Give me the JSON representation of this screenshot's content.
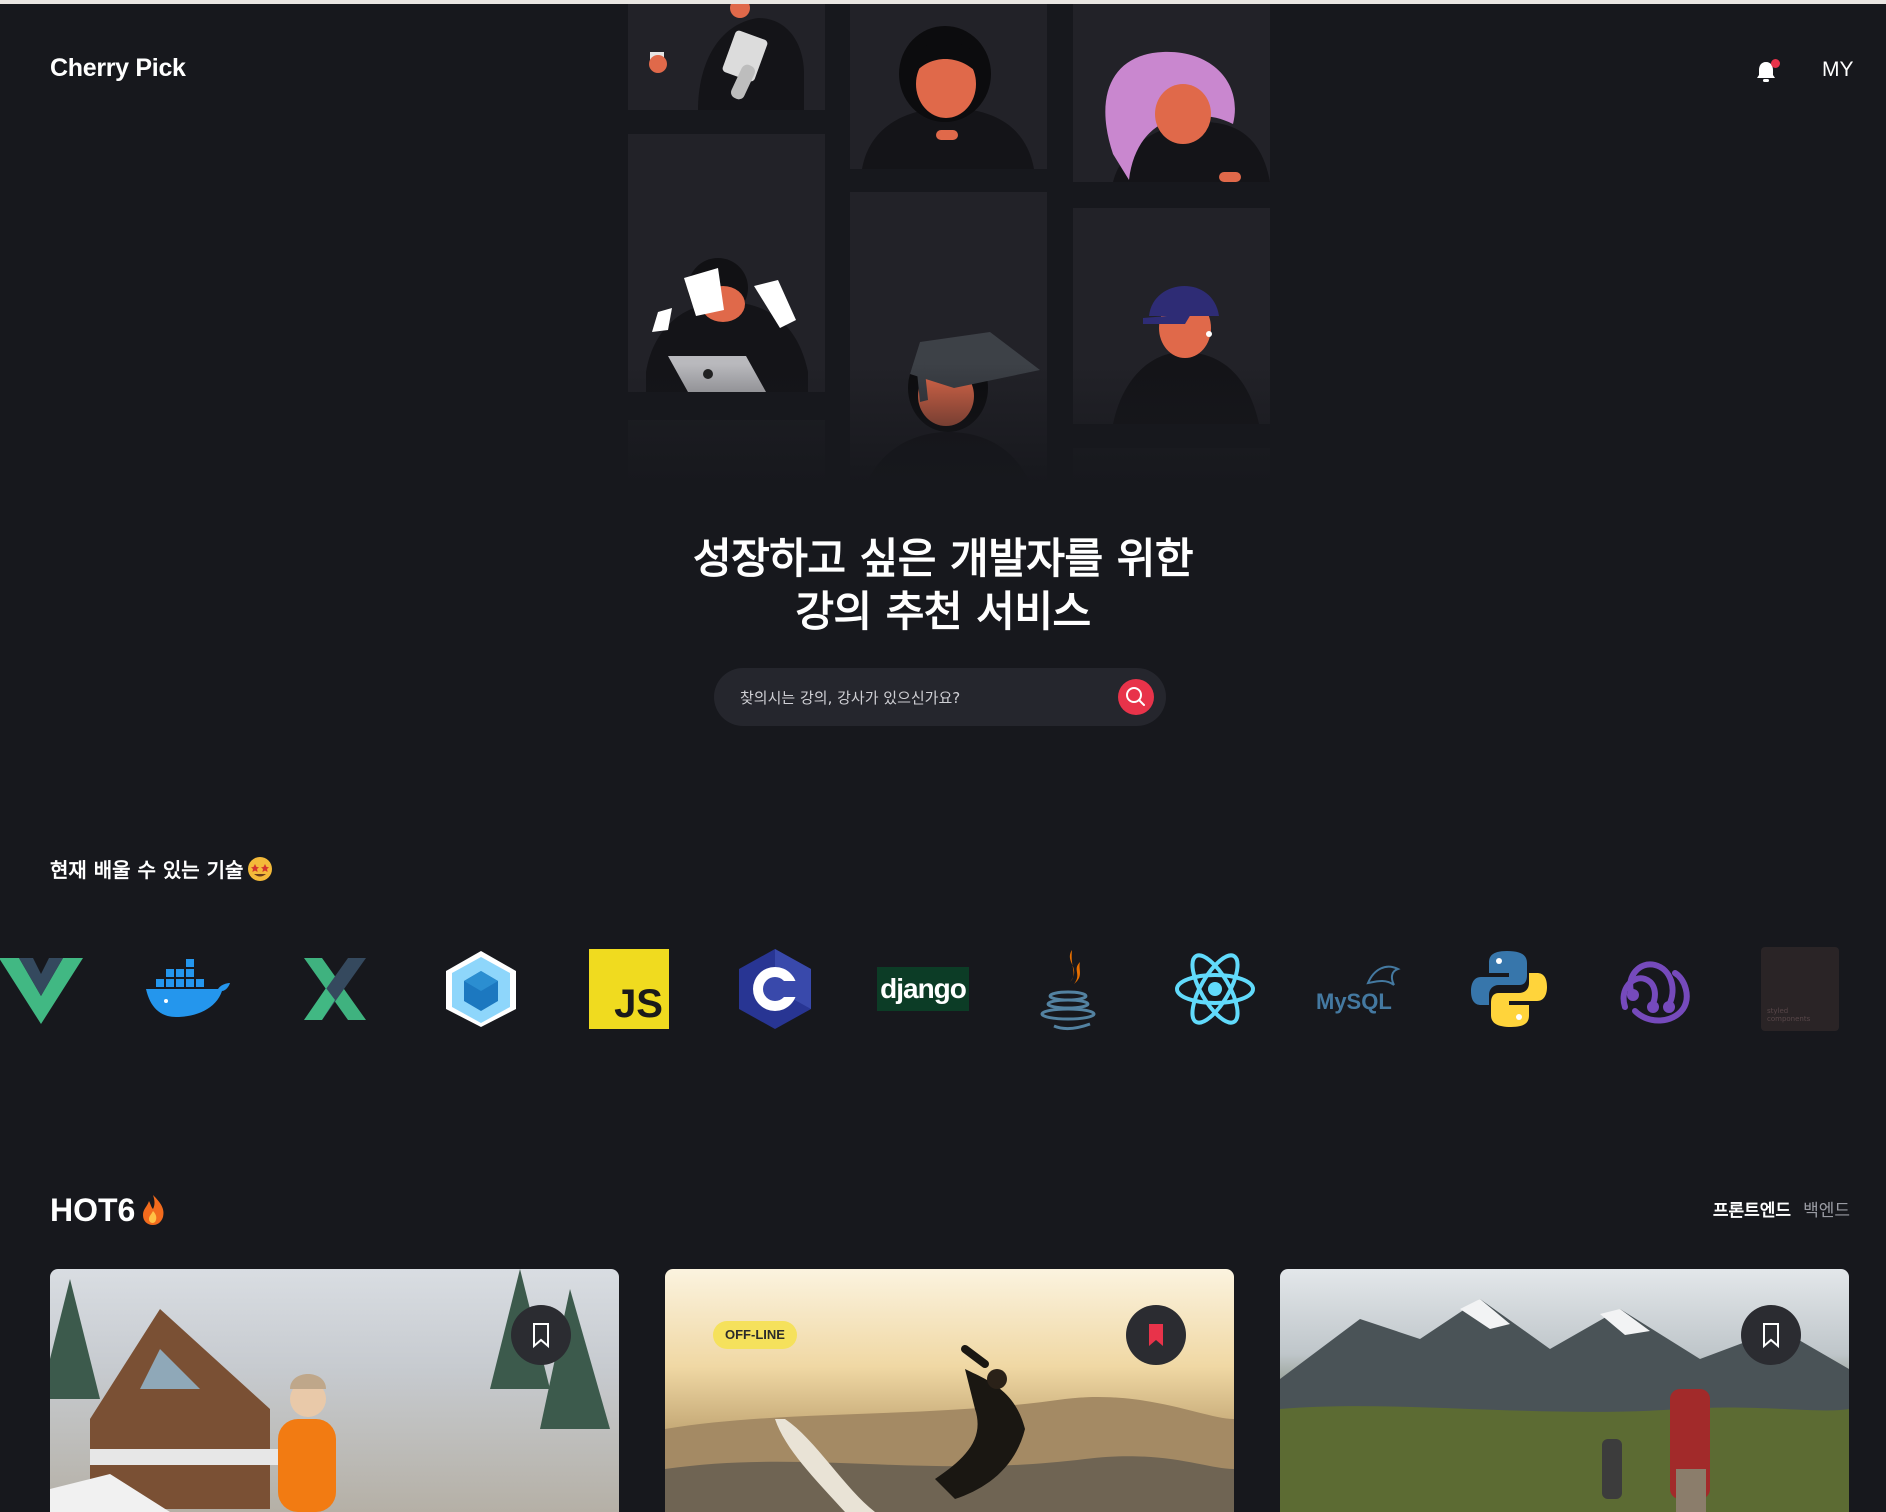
{
  "header": {
    "logo": "Cherry Pick",
    "my_label": "MY"
  },
  "hero": {
    "headline_line1": "성장하고 싶은 개발자를 위한",
    "headline_line2": "강의 추천 서비스"
  },
  "search": {
    "placeholder": "찾의시는 강의, 강사가 있으신가요?"
  },
  "tech_section": {
    "title": "현재 배울 수 있는 기술",
    "logos": [
      "vue",
      "docker",
      "nuxt",
      "webpack",
      "javascript",
      "c",
      "django",
      "java",
      "react",
      "mysql",
      "python",
      "redux",
      "styled-components"
    ],
    "js_text": "JS",
    "django_text": "django",
    "mysql_text": "MySQL",
    "styled_text": "styled components"
  },
  "hot": {
    "title": "HOT6",
    "tabs": [
      "프론트엔드",
      "백엔드"
    ],
    "active_tab": "프론트엔드",
    "cards": [
      {
        "image": "snowy-cabin-woman-orange-jacket",
        "bookmarked": false
      },
      {
        "image": "surfer-wave",
        "bookmarked": true,
        "badge": "OFF-LINE"
      },
      {
        "image": "mountain-hikers",
        "bookmarked": false
      }
    ]
  },
  "colors": {
    "background": "#17181d",
    "accent": "#e8334a",
    "search_bg": "#25262d",
    "badge": "#f5e15c"
  }
}
